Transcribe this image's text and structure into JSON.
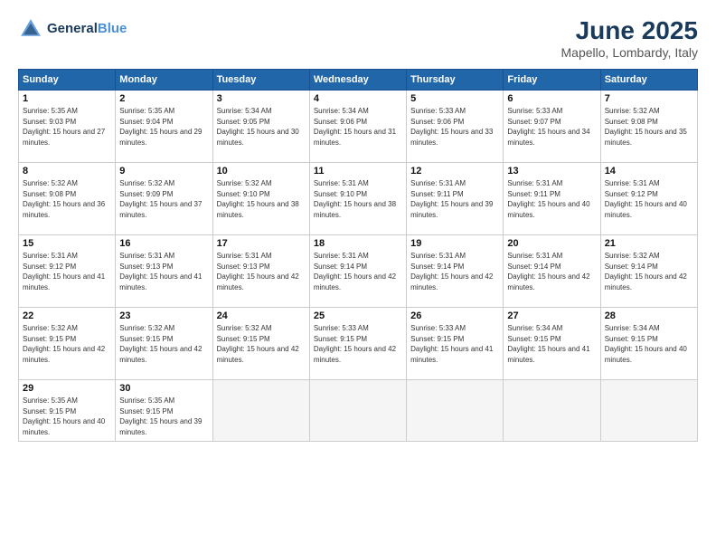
{
  "header": {
    "logo_line1": "General",
    "logo_line2": "Blue",
    "title": "June 2025",
    "subtitle": "Mapello, Lombardy, Italy"
  },
  "days_of_week": [
    "Sunday",
    "Monday",
    "Tuesday",
    "Wednesday",
    "Thursday",
    "Friday",
    "Saturday"
  ],
  "weeks": [
    [
      {
        "num": "1",
        "rise": "5:35 AM",
        "set": "9:03 PM",
        "daylight": "15 hours and 27 minutes."
      },
      {
        "num": "2",
        "rise": "5:35 AM",
        "set": "9:04 PM",
        "daylight": "15 hours and 29 minutes."
      },
      {
        "num": "3",
        "rise": "5:34 AM",
        "set": "9:05 PM",
        "daylight": "15 hours and 30 minutes."
      },
      {
        "num": "4",
        "rise": "5:34 AM",
        "set": "9:06 PM",
        "daylight": "15 hours and 31 minutes."
      },
      {
        "num": "5",
        "rise": "5:33 AM",
        "set": "9:06 PM",
        "daylight": "15 hours and 33 minutes."
      },
      {
        "num": "6",
        "rise": "5:33 AM",
        "set": "9:07 PM",
        "daylight": "15 hours and 34 minutes."
      },
      {
        "num": "7",
        "rise": "5:32 AM",
        "set": "9:08 PM",
        "daylight": "15 hours and 35 minutes."
      }
    ],
    [
      {
        "num": "8",
        "rise": "5:32 AM",
        "set": "9:08 PM",
        "daylight": "15 hours and 36 minutes."
      },
      {
        "num": "9",
        "rise": "5:32 AM",
        "set": "9:09 PM",
        "daylight": "15 hours and 37 minutes."
      },
      {
        "num": "10",
        "rise": "5:32 AM",
        "set": "9:10 PM",
        "daylight": "15 hours and 38 minutes."
      },
      {
        "num": "11",
        "rise": "5:31 AM",
        "set": "9:10 PM",
        "daylight": "15 hours and 38 minutes."
      },
      {
        "num": "12",
        "rise": "5:31 AM",
        "set": "9:11 PM",
        "daylight": "15 hours and 39 minutes."
      },
      {
        "num": "13",
        "rise": "5:31 AM",
        "set": "9:11 PM",
        "daylight": "15 hours and 40 minutes."
      },
      {
        "num": "14",
        "rise": "5:31 AM",
        "set": "9:12 PM",
        "daylight": "15 hours and 40 minutes."
      }
    ],
    [
      {
        "num": "15",
        "rise": "5:31 AM",
        "set": "9:12 PM",
        "daylight": "15 hours and 41 minutes."
      },
      {
        "num": "16",
        "rise": "5:31 AM",
        "set": "9:13 PM",
        "daylight": "15 hours and 41 minutes."
      },
      {
        "num": "17",
        "rise": "5:31 AM",
        "set": "9:13 PM",
        "daylight": "15 hours and 42 minutes."
      },
      {
        "num": "18",
        "rise": "5:31 AM",
        "set": "9:14 PM",
        "daylight": "15 hours and 42 minutes."
      },
      {
        "num": "19",
        "rise": "5:31 AM",
        "set": "9:14 PM",
        "daylight": "15 hours and 42 minutes."
      },
      {
        "num": "20",
        "rise": "5:31 AM",
        "set": "9:14 PM",
        "daylight": "15 hours and 42 minutes."
      },
      {
        "num": "21",
        "rise": "5:32 AM",
        "set": "9:14 PM",
        "daylight": "15 hours and 42 minutes."
      }
    ],
    [
      {
        "num": "22",
        "rise": "5:32 AM",
        "set": "9:15 PM",
        "daylight": "15 hours and 42 minutes."
      },
      {
        "num": "23",
        "rise": "5:32 AM",
        "set": "9:15 PM",
        "daylight": "15 hours and 42 minutes."
      },
      {
        "num": "24",
        "rise": "5:32 AM",
        "set": "9:15 PM",
        "daylight": "15 hours and 42 minutes."
      },
      {
        "num": "25",
        "rise": "5:33 AM",
        "set": "9:15 PM",
        "daylight": "15 hours and 42 minutes."
      },
      {
        "num": "26",
        "rise": "5:33 AM",
        "set": "9:15 PM",
        "daylight": "15 hours and 41 minutes."
      },
      {
        "num": "27",
        "rise": "5:34 AM",
        "set": "9:15 PM",
        "daylight": "15 hours and 41 minutes."
      },
      {
        "num": "28",
        "rise": "5:34 AM",
        "set": "9:15 PM",
        "daylight": "15 hours and 40 minutes."
      }
    ],
    [
      {
        "num": "29",
        "rise": "5:35 AM",
        "set": "9:15 PM",
        "daylight": "15 hours and 40 minutes."
      },
      {
        "num": "30",
        "rise": "5:35 AM",
        "set": "9:15 PM",
        "daylight": "15 hours and 39 minutes."
      },
      null,
      null,
      null,
      null,
      null
    ]
  ]
}
